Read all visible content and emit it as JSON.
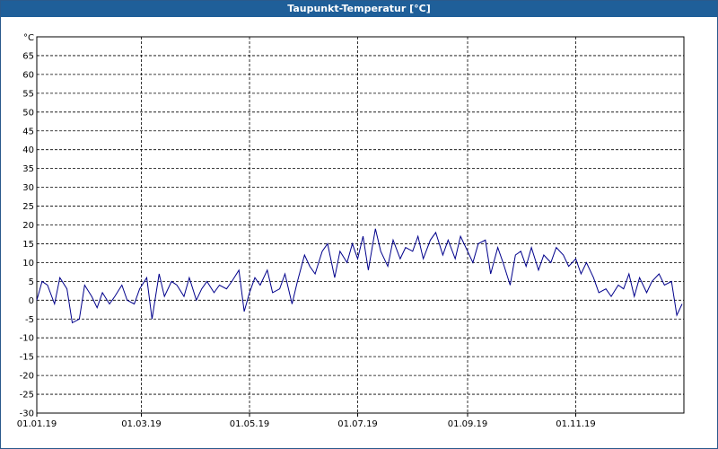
{
  "window": {
    "title": "Taupunkt-Temperatur [°C]"
  },
  "chart_data": {
    "type": "line",
    "title": "Taupunkt-Temperatur [°C]",
    "ylabel": "°C",
    "xlabel": "",
    "x_range": [
      "2019-01-01",
      "2019-12-31"
    ],
    "ylim": [
      -30,
      70
    ],
    "y_ticks": [
      -30,
      -25,
      -20,
      -15,
      -10,
      -5,
      0,
      5,
      10,
      15,
      20,
      25,
      30,
      35,
      40,
      45,
      50,
      55,
      60,
      65
    ],
    "x_ticks": [
      {
        "date": "2019-01-01",
        "label": "01.01.19"
      },
      {
        "date": "2019-03-01",
        "label": "01.03.19"
      },
      {
        "date": "2019-05-01",
        "label": "01.05.19"
      },
      {
        "date": "2019-07-01",
        "label": "01.07.19"
      },
      {
        "date": "2019-09-01",
        "label": "01.09.19"
      },
      {
        "date": "2019-11-01",
        "label": "01.11.19"
      }
    ],
    "grid": true,
    "line_color": "#00008b",
    "series": [
      {
        "x": [
          "2019-01-01",
          "2019-01-04",
          "2019-01-07",
          "2019-01-11",
          "2019-01-14",
          "2019-01-18",
          "2019-01-21",
          "2019-01-25",
          "2019-01-28",
          "2019-02-01",
          "2019-02-04",
          "2019-02-07",
          "2019-02-11",
          "2019-02-14",
          "2019-02-18",
          "2019-02-21",
          "2019-02-25",
          "2019-02-28",
          "2019-03-04",
          "2019-03-07",
          "2019-03-11",
          "2019-03-14",
          "2019-03-18",
          "2019-03-21",
          "2019-03-25",
          "2019-03-28",
          "2019-04-01",
          "2019-04-04",
          "2019-04-07",
          "2019-04-11",
          "2019-04-14",
          "2019-04-18",
          "2019-04-21",
          "2019-04-25",
          "2019-04-28",
          "2019-05-01",
          "2019-05-04",
          "2019-05-07",
          "2019-05-11",
          "2019-05-14",
          "2019-05-18",
          "2019-05-21",
          "2019-05-25",
          "2019-05-28",
          "2019-06-01",
          "2019-06-04",
          "2019-06-07",
          "2019-06-11",
          "2019-06-14",
          "2019-06-18",
          "2019-06-21",
          "2019-06-25",
          "2019-06-28",
          "2019-07-01",
          "2019-07-04",
          "2019-07-07",
          "2019-07-11",
          "2019-07-14",
          "2019-07-18",
          "2019-07-21",
          "2019-07-25",
          "2019-07-28",
          "2019-08-01",
          "2019-08-04",
          "2019-08-07",
          "2019-08-11",
          "2019-08-14",
          "2019-08-18",
          "2019-08-21",
          "2019-08-25",
          "2019-08-28",
          "2019-09-01",
          "2019-09-04",
          "2019-09-07",
          "2019-09-11",
          "2019-09-14",
          "2019-09-18",
          "2019-09-21",
          "2019-09-25",
          "2019-09-28",
          "2019-10-01",
          "2019-10-04",
          "2019-10-07",
          "2019-10-11",
          "2019-10-14",
          "2019-10-18",
          "2019-10-21",
          "2019-10-25",
          "2019-10-28",
          "2019-11-01",
          "2019-11-04",
          "2019-11-07",
          "2019-11-11",
          "2019-11-14",
          "2019-11-18",
          "2019-11-21",
          "2019-11-25",
          "2019-11-28",
          "2019-12-01",
          "2019-12-04",
          "2019-12-07",
          "2019-12-11",
          "2019-12-14",
          "2019-12-18",
          "2019-12-21",
          "2019-12-25",
          "2019-12-28",
          "2019-12-31"
        ],
        "values": [
          0,
          5,
          4,
          -1,
          6,
          3,
          -6,
          -5,
          4,
          1,
          -2,
          2,
          -1,
          1,
          4,
          0,
          -1,
          3,
          6,
          -5,
          7,
          1,
          5,
          4,
          1,
          6,
          0,
          3,
          5,
          2,
          4,
          3,
          5,
          8,
          -3,
          2,
          6,
          4,
          8,
          2,
          3,
          7,
          -1,
          5,
          12,
          9,
          7,
          13,
          15,
          6,
          13,
          10,
          15,
          11,
          17,
          8,
          19,
          13,
          9,
          16,
          11,
          14,
          13,
          17,
          11,
          16,
          18,
          12,
          16,
          11,
          17,
          13,
          10,
          15,
          16,
          7,
          14,
          10,
          4,
          12,
          13,
          9,
          14,
          8,
          12,
          10,
          14,
          12,
          9,
          11,
          7,
          10,
          6,
          2,
          3,
          1,
          4,
          3,
          7,
          1,
          6,
          2,
          5,
          7,
          4,
          5,
          -4,
          -1
        ]
      }
    ]
  }
}
